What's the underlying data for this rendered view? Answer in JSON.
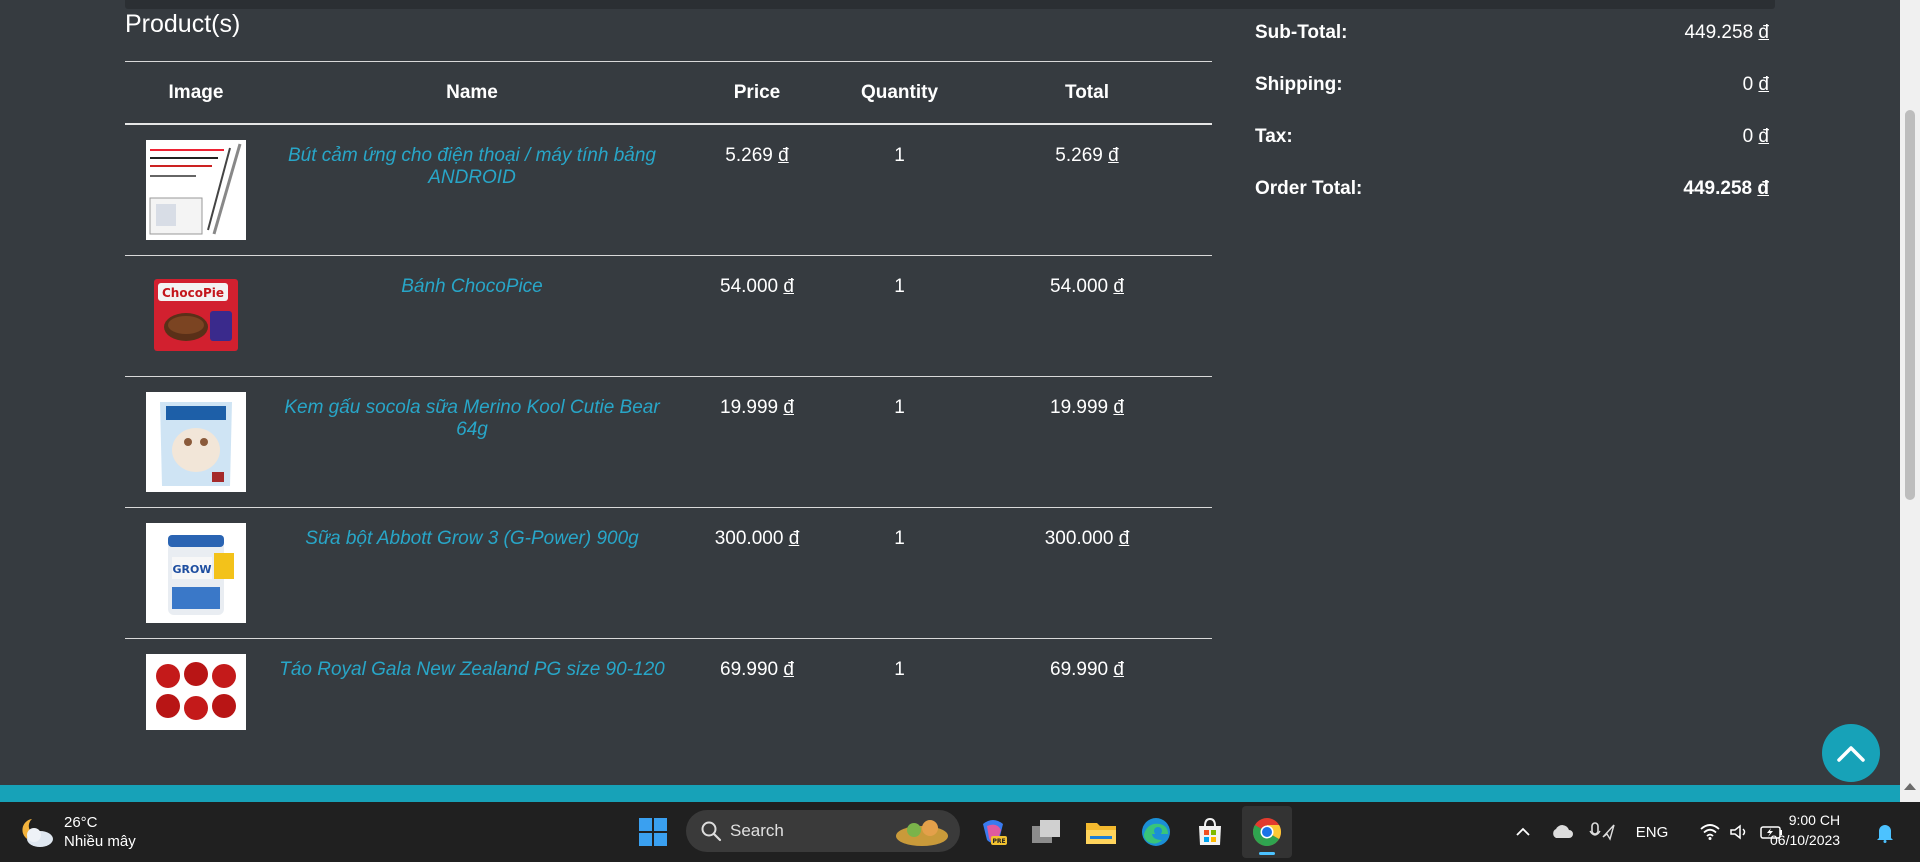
{
  "products": {
    "title": "Product(s)",
    "columns": [
      "Image",
      "Name",
      "Price",
      "Quantity",
      "Total"
    ],
    "rows": [
      {
        "name": "Bút cảm ứng cho điện thoại / máy tính bảng ANDROID",
        "price": "5.269",
        "quantity": "1",
        "total": "5.269",
        "image": "stylus-pens-image"
      },
      {
        "name": "Bánh ChocoPice",
        "price": "54.000",
        "quantity": "1",
        "total": "54.000",
        "image": "chocopie-box-image"
      },
      {
        "name": "Kem gấu socola sữa Merino Kool Cutie Bear 64g",
        "price": "19.999",
        "quantity": "1",
        "total": "19.999",
        "image": "ice-cream-package-image"
      },
      {
        "name": "Sữa bột Abbott Grow 3 (G-Power) 900g",
        "price": "300.000",
        "quantity": "1",
        "total": "300.000",
        "image": "milk-powder-can-image"
      },
      {
        "name": "Táo Royal Gala New Zealand PG size 90-120",
        "price": "69.990",
        "quantity": "1",
        "total": "69.990",
        "image": "red-apples-image"
      }
    ],
    "currency": "đ"
  },
  "summary": {
    "subtotal_label": "Sub-Total:",
    "subtotal": "449.258",
    "shipping_label": "Shipping:",
    "shipping": "0",
    "tax_label": "Tax:",
    "tax": "0",
    "total_label": "Order Total:",
    "total": "449.258"
  },
  "taskbar": {
    "weather_temp": "26°C",
    "weather_desc": "Nhiều mây",
    "search_label": "Search",
    "language": "ENG",
    "time": "9:00 CH",
    "date": "06/10/2023"
  },
  "colors": {
    "background": "#363b40",
    "link": "#28a6c8",
    "accent": "#17a2b8",
    "taskbar": "#202020"
  }
}
